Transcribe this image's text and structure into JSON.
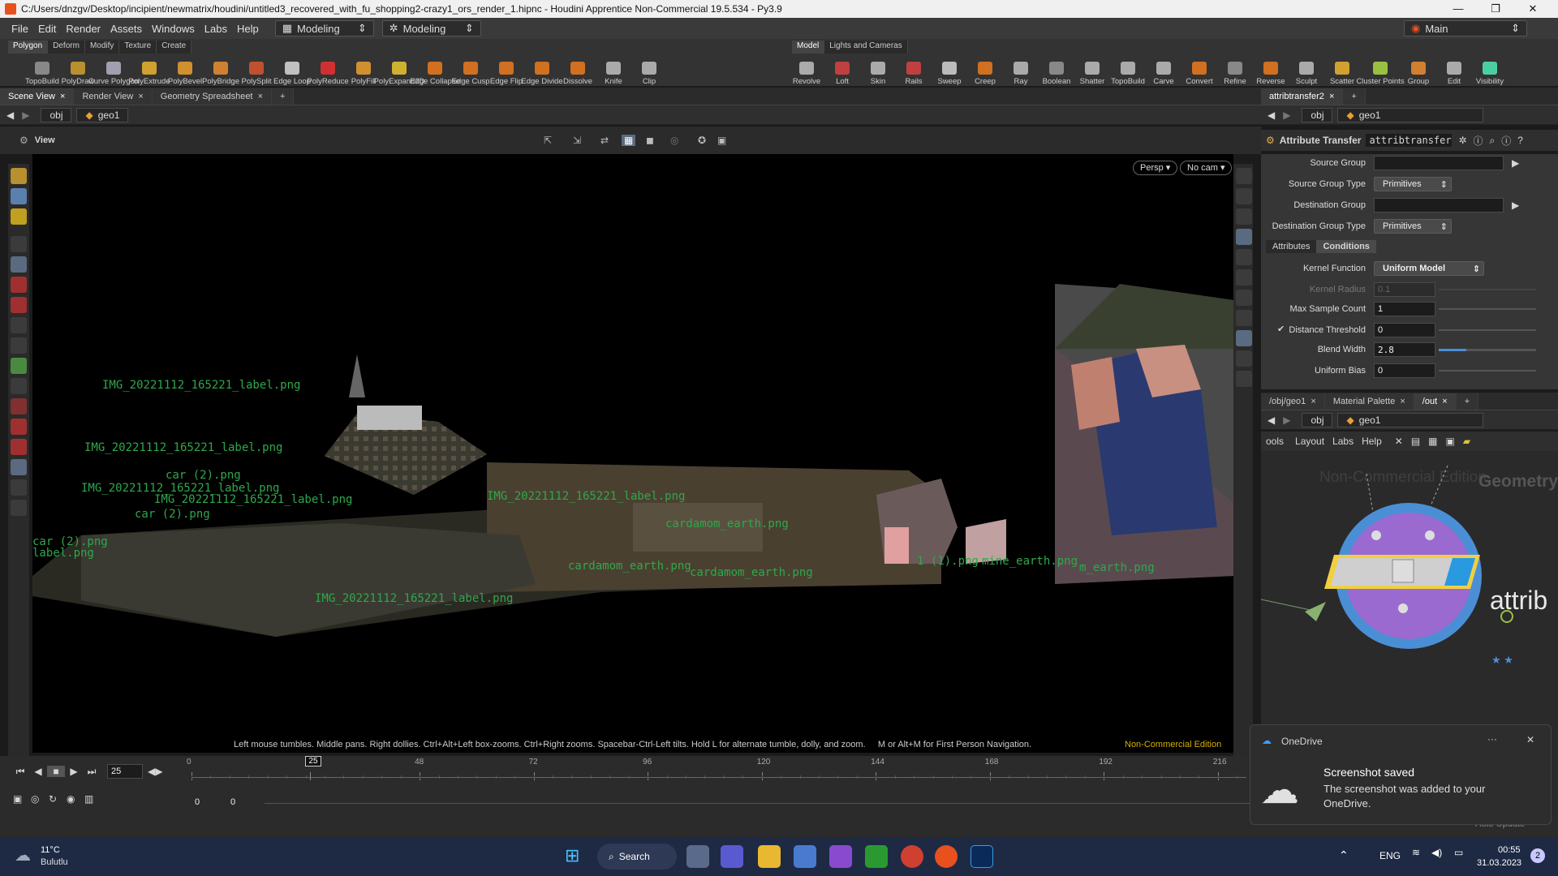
{
  "window": {
    "title": "C:/Users/dnzgv/Desktop/incipient/newmatrix/houdini/untitled3_recovered_with_fu_shopping2-crazy1_ors_render_1.hipnc - Houdini Apprentice Non-Commercial 19.5.534 - Py3.9"
  },
  "menu": {
    "items": [
      "File",
      "Edit",
      "Render",
      "Assets",
      "Windows",
      "Labs",
      "Help"
    ],
    "desktop1": "Modeling",
    "desktop2": "Modeling",
    "main": "Main"
  },
  "shelf": {
    "tabs_left": [
      "Polygon",
      "Deform",
      "Modify",
      "Texture",
      "Create"
    ],
    "tabs_right": [
      "Model",
      "Lights and Cameras"
    ],
    "tools_left": [
      "TopoBuild",
      "PolyDraw",
      "Curve Polygon",
      "PolyExtrude",
      "PolyBevel",
      "PolyBridge",
      "PolySplit",
      "Edge Loop",
      "PolyReduce",
      "PolyFill",
      "PolyExpand2D",
      "Edge Collapse",
      "Edge Cusp",
      "Edge Flip",
      "Edge Divide",
      "Dissolve",
      "Knife",
      "Clip"
    ],
    "tools_right": [
      "Revolve",
      "Loft",
      "Skin",
      "Rails",
      "Sweep",
      "Creep",
      "Ray",
      "Boolean",
      "Shatter",
      "TopoBuild",
      "Carve",
      "Convert",
      "Refine",
      "Reverse",
      "Sculpt",
      "Scatter",
      "Cluster Points",
      "Group",
      "Edit",
      "Visibility"
    ]
  },
  "scene": {
    "tabs": [
      "Scene View",
      "Render View",
      "Geometry Spreadsheet"
    ],
    "path_obj": "obj",
    "path_geo": "geo1",
    "view_label": "View",
    "persp": "Persp ▾",
    "cam": "No cam ▾",
    "help": "Left mouse tumbles. Middle pans. Right dollies. Ctrl+Alt+Left box-zooms. Ctrl+Right zooms. Spacebar-Ctrl-Left tilts. Hold L for alternate tumble, dolly, and zoom.     M or Alt+M for First Person Navigation.",
    "edition": "Non-Commercial Edition",
    "labels": [
      "IMG_20221112_165221_label.png",
      "IMG_20221112_165221_label.png",
      "IMG_20221112_165221_label.png",
      "car (2).png",
      "IMG_20221112_165221_label.png",
      "car (2).png",
      "label.png",
      "car (2).png",
      "IMG_20221112_165221_label.png",
      "cardamom_earth.png",
      "cardamom_earth.png",
      "cardamom_earth.png",
      "1 (1).png",
      "mine_earth.png",
      "IMG_20221112_165221_label.png",
      "m_earth.png"
    ]
  },
  "params": {
    "tab": "attribtransfer2",
    "path_obj": "obj",
    "path_geo": "geo1",
    "node_type": "Attribute Transfer",
    "node_name": "attribtransfer2",
    "source_group": "Source Group",
    "source_group_type": "Source Group Type",
    "source_group_type_val": "Primitives",
    "dest_group": "Destination Group",
    "dest_group_type": "Destination Group Type",
    "dest_group_type_val": "Primitives",
    "tab_attributes": "Attributes",
    "tab_conditions": "Conditions",
    "kernel_function": "Kernel Function",
    "kernel_function_val": "Uniform Model",
    "kernel_radius": "Kernel Radius",
    "kernel_radius_val": "0.1",
    "max_sample": "Max Sample Count",
    "max_sample_val": "1",
    "dist_threshold": "Distance Threshold",
    "dist_threshold_val": "0",
    "blend_width": "Blend Width",
    "blend_width_val": "2.8",
    "uniform_bias": "Uniform Bias",
    "uniform_bias_val": "0"
  },
  "network": {
    "tabs": [
      "/obj/geo1",
      "Material Palette",
      "/out"
    ],
    "path_obj": "obj",
    "path_geo": "geo1",
    "menu": [
      "ools",
      "Layout",
      "Labs",
      "Help"
    ],
    "watermark": "Non-Commercial Edition",
    "context": "Geometry",
    "node_label": "attrib"
  },
  "timeline": {
    "frame": "25",
    "ticks": [
      "0",
      "25",
      "48",
      "72",
      "96",
      "120",
      "144",
      "168",
      "192",
      "216"
    ],
    "start": "0",
    "end": "0",
    "auto_update": "Auto Update"
  },
  "toast": {
    "app": "OneDrive",
    "title": "Screenshot saved",
    "body": "The screenshot was added to your OneDrive."
  },
  "taskbar": {
    "temp": "11°C",
    "weather": "Bulutlu",
    "search": "Search",
    "lang": "ENG",
    "time": "00:55",
    "date": "31.03.2023",
    "badge": "2"
  },
  "colors": {
    "accent": "#e8501e",
    "label": "#2fa84a",
    "node_blue": "#4a8fd6",
    "node_purple": "#9a6ad0"
  }
}
